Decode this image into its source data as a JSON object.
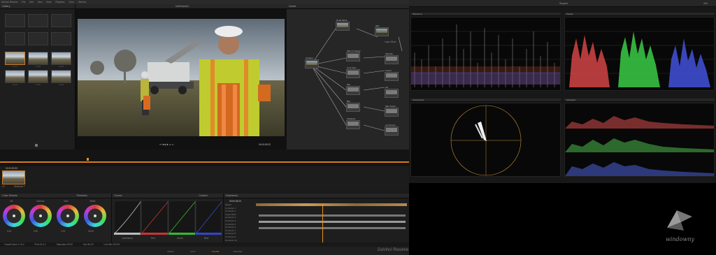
{
  "menubar": {
    "app": "DaVinci Resolve",
    "items": [
      "File",
      "Edit",
      "View",
      "Mark",
      "Playback",
      "Color",
      "Window"
    ]
  },
  "gallery": {
    "title": "Gallery",
    "stills": [
      "1.1.1",
      "1.1.2",
      "1.1.3",
      "1.1.4",
      "1.1.5",
      "1.1.6"
    ]
  },
  "viewer": {
    "timeline_name": "CalRoses01",
    "timecode": "01:00:00:22",
    "zoom": "1"
  },
  "nodes": {
    "title": "Nodes",
    "items": [
      "Outdoor",
      "Node Mode",
      "Skin & Orange",
      "Cool Flow",
      "Sat",
      "Blur",
      "Shadows",
      "Skin",
      "Vignette",
      "Colour",
      "Lift",
      "Skin Tones",
      "Luminance",
      "Layer Mixer",
      "Primary"
    ]
  },
  "clips": {
    "timecode": "01:00:00:00",
    "clip_label": "V1",
    "clip_name": "Windows Y"
  },
  "color_wheels": {
    "title": "Color Wheels",
    "mode": "Primaries",
    "wheels": [
      "Lift",
      "Gamma",
      "Gain",
      "Offset"
    ],
    "values": [
      "0.00",
      "0.00",
      "1.00",
      "25.00"
    ]
  },
  "curves": {
    "title": "Curves",
    "channels": [
      "Luminance",
      "Red",
      "Green",
      "Blue"
    ],
    "mode": "Custom"
  },
  "keyframes": {
    "title": "Keyframes",
    "timecode": "00:00:05:20",
    "tracks": [
      "Master",
      "Corrector 1",
      "Corrector 2",
      "Layer Mixer",
      "Corrector 3",
      "Corrector 4",
      "Corrector 5",
      "Corrector 6",
      "Corrector 7",
      "Corrector 8",
      "Corrector 9",
      "Corrector 10"
    ]
  },
  "status": {
    "items": [
      "FrameFusion 1.19.0",
      "Pixel ID 4.1",
      "Saturation 50.00",
      "Hue 50.00",
      "Lum Mix 100.00"
    ],
    "brand": "DaVinci Resolve"
  },
  "pages": {
    "tabs": [
      "MEDIA",
      "EDIT",
      "COLOR",
      "DELIVER"
    ],
    "selected": "COLOR"
  },
  "scopes": {
    "title": "Scopes",
    "layout": "2x2",
    "waveform": "Waveform",
    "parade": "Parade",
    "vectorscope": "Vectorscope",
    "histogram": "Histogram"
  },
  "watermark": {
    "text": "windowny"
  }
}
